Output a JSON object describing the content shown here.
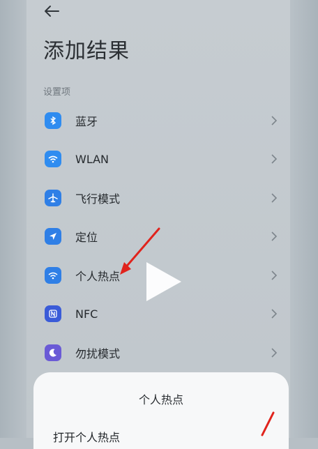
{
  "header": {
    "back_icon": "arrow-left-icon",
    "title": "添加结果"
  },
  "section": {
    "label": "设置项"
  },
  "items": [
    {
      "label": "蓝牙",
      "icon": "bluetooth-icon",
      "color": "#2f8cf0"
    },
    {
      "label": "WLAN",
      "icon": "wifi-icon",
      "color": "#2f8cf0"
    },
    {
      "label": "飞行模式",
      "icon": "airplane-icon",
      "color": "#2f7fe6"
    },
    {
      "label": "定位",
      "icon": "location-icon",
      "color": "#2f7fe6"
    },
    {
      "label": "个人热点",
      "icon": "hotspot-icon",
      "color": "#2f7fe6"
    },
    {
      "label": "NFC",
      "icon": "nfc-icon",
      "color": "#3a5bd8"
    },
    {
      "label": "勿扰模式",
      "icon": "moon-icon",
      "color": "#6a5ad6"
    }
  ],
  "overlay": {
    "play_icon": "play-icon",
    "arrow_color": "#e0231c"
  },
  "sheet": {
    "title": "个人热点",
    "item": "打开个人热点"
  }
}
